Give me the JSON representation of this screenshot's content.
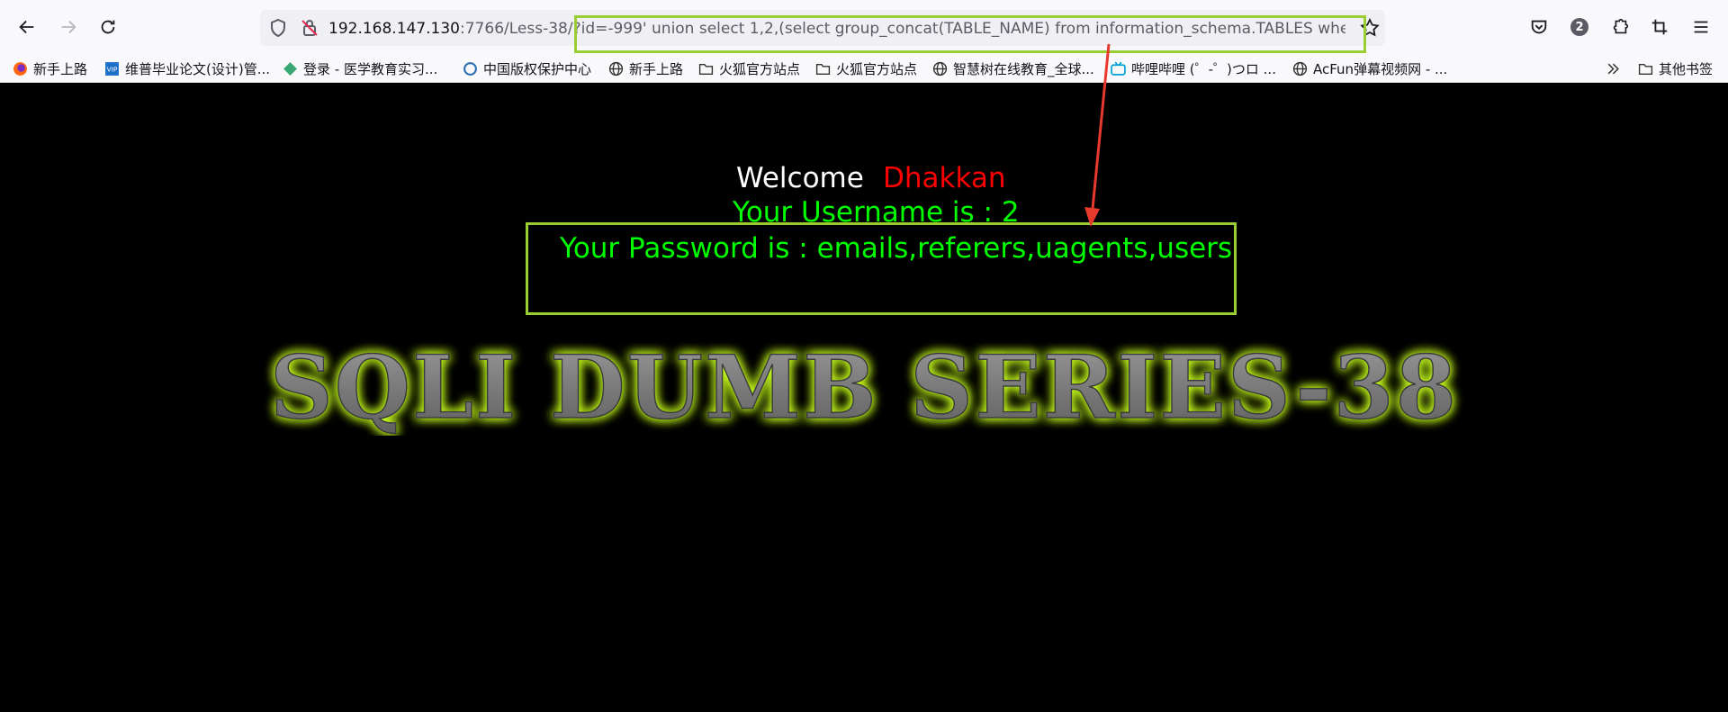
{
  "browser": {
    "url_host": "192.168.147.130",
    "url_rest": ":7766/Less-38/?id=-999' union select 1,2,(select group_concat(TABLE_NAME) from information_schema.TABLES where TAB",
    "extensions_badge": "2"
  },
  "bookmarks": [
    {
      "label": "新手上路",
      "icon": "firefox-icon"
    },
    {
      "label": "维普毕业论文(设计)管...",
      "icon": "vip-icon"
    },
    {
      "label": "登录 - 医学教育实习...",
      "icon": "site-icon"
    },
    {
      "label": "中国版权保护中心",
      "icon": "site-icon"
    },
    {
      "label": "新手上路",
      "icon": "globe-icon"
    },
    {
      "label": "火狐官方站点",
      "icon": "folder-icon"
    },
    {
      "label": "火狐官方站点",
      "icon": "folder-icon"
    },
    {
      "label": "智慧树在线教育_全球...",
      "icon": "globe-icon"
    },
    {
      "label": "哔哩哔哩 (゜-゜)つロ ...",
      "icon": "bilibili-icon"
    },
    {
      "label": "AcFun弹幕视频网 - ...",
      "icon": "globe-icon"
    }
  ],
  "other_bookmarks": "其他书签",
  "page": {
    "welcome": "Welcome",
    "name": "Dhakkan",
    "username_line": "Your Username is : 2",
    "password_line": "Your Password is : emails,referers,uagents,users",
    "title": "SQLI DUMB SERIES-38"
  },
  "colors": {
    "highlight": "#9acd32",
    "green_text": "#00ff00",
    "red_text": "#ff0000",
    "arrow": "#e8392f"
  }
}
